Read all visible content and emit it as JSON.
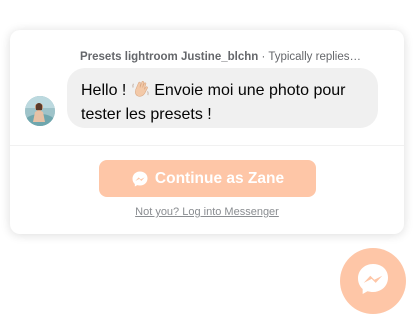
{
  "chat": {
    "page_name": "Presets lightroom Justine_blchn",
    "reply_time": "· Typically replies…",
    "message_part1": "Hello ! ",
    "message_emoji": "waving-hand",
    "message_part2": " Envoie moi une photo pour tester les presets !"
  },
  "actions": {
    "continue_label": "Continue as Zane",
    "login_link": "Not you? Log into Messenger"
  },
  "colors": {
    "accent": "#fec6a7",
    "bubble": "#f0f0f0",
    "muted_text": "#65676b"
  },
  "icons": {
    "button_icon": "messenger-icon",
    "fab_icon": "messenger-icon"
  }
}
